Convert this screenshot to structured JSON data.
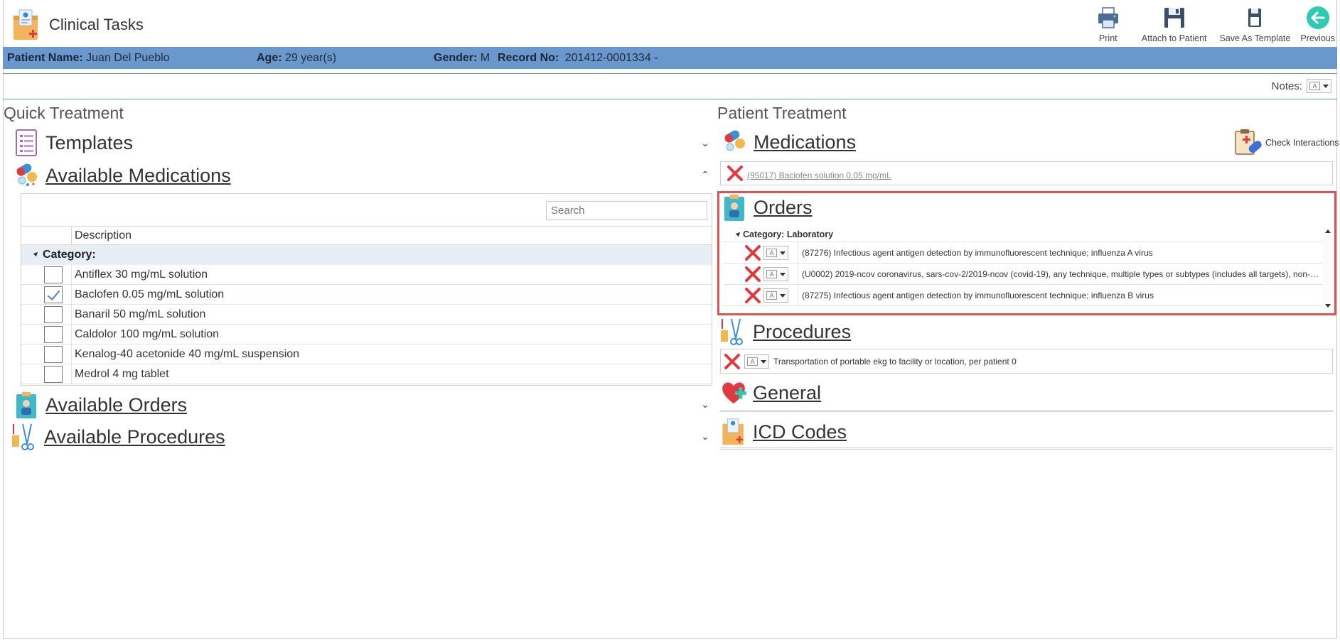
{
  "header": {
    "title": "Clinical Tasks",
    "toolbar": [
      {
        "label": "Print",
        "icon": "printer-icon"
      },
      {
        "label": "Attach to Patient",
        "icon": "floppy-disk-icon"
      },
      {
        "label": "Save As Template",
        "icon": "save-template-icon"
      },
      {
        "label": "Previous",
        "icon": "arrow-left-circle-icon"
      }
    ]
  },
  "patient": {
    "name_label": "Patient Name:",
    "name": "Juan Del Pueblo",
    "age_label": "Age:",
    "age": "29 year(s)",
    "gender_label": "Gender:",
    "gender": "M",
    "record_label": "Record No:",
    "record": "201412-0001334 -"
  },
  "notes": {
    "label": "Notes:"
  },
  "quick_treatment": {
    "title": "Quick Treatment",
    "sections": {
      "templates": "Templates",
      "available_medications": "Available Medications",
      "available_orders": "Available Orders",
      "available_procedures": "Available Procedures"
    },
    "search_placeholder": "Search",
    "column_description": "Description",
    "category_label": "Category:",
    "medications": [
      {
        "name": "Antiflex 30 mg/mL solution",
        "checked": false
      },
      {
        "name": "Baclofen 0.05 mg/mL solution",
        "checked": true
      },
      {
        "name": "Banaril 50 mg/mL solution",
        "checked": false
      },
      {
        "name": "Caldolor 100 mg/mL solution",
        "checked": false
      },
      {
        "name": "Kenalog-40 acetonide 40 mg/mL suspension",
        "checked": false
      },
      {
        "name": "Medrol 4 mg tablet",
        "checked": false
      }
    ]
  },
  "patient_treatment": {
    "title": "Patient Treatment",
    "medications_title": "Medications",
    "check_interactions": "Check Interactions",
    "medication_items": [
      "(95017) Baclofen solution 0.05 mg/mL"
    ],
    "orders_title": "Orders",
    "orders_category": "Category: Laboratory",
    "orders": [
      "(87276) Infectious agent antigen detection by immunofluorescent technique; influenza A virus",
      "(U0002) 2019-ncov coronavirus, sars-cov-2/2019-ncov (covid-19), any technique, multiple types or subtypes (includes all targets), non-c...",
      "(87275) Infectious agent antigen detection by immunofluorescent technique; influenza B virus"
    ],
    "procedures_title": "Procedures",
    "procedures": [
      "Transportation of portable ekg to facility or location, per patient 0"
    ],
    "general_title": "General",
    "icd_title": "ICD Codes"
  },
  "colors": {
    "accent": "#6a97cc",
    "highlight": "#e05353",
    "delete": "#e0393f"
  }
}
